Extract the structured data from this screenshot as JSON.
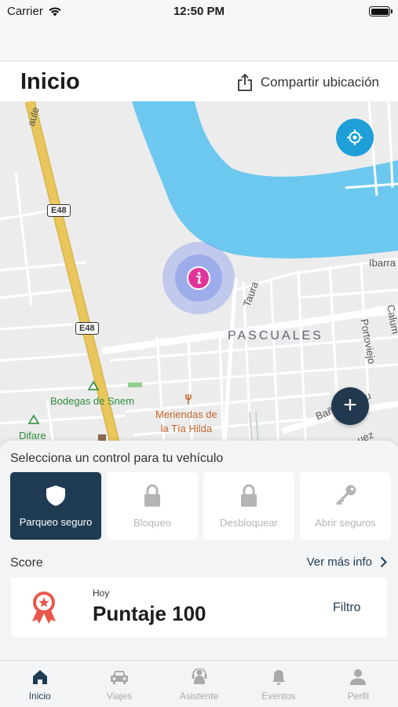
{
  "status_bar": {
    "carrier": "Carrier",
    "time": "12:50 PM"
  },
  "header": {
    "title": "Inicio",
    "share_label": "Compartir ubicación"
  },
  "map": {
    "labels": {
      "road_top_left": "aule",
      "highway_1": "E48",
      "highway_2": "E48",
      "district": "PASCUALES",
      "taura": "Taura",
      "ibarra": "Ibarra",
      "portoviejo": "Portoviejo",
      "calum": "Calum",
      "banos": "Baños De Ju",
      "juez": "uez",
      "bodegas": "Bodegas de Snem",
      "difare": "Difare",
      "meriendas_1": "Meriendas de",
      "meriendas_2": "la Tía Hilda"
    },
    "river_color": "#6cc8ef",
    "highway_color": "#e9c75d"
  },
  "controls": {
    "heading": "Selecciona un control para tu vehículo",
    "items": [
      {
        "label": "Parqueo seguro",
        "icon": "shield-icon",
        "active": true
      },
      {
        "label": "Bloqueo",
        "icon": "lock-icon",
        "active": false
      },
      {
        "label": "Desbloquear",
        "icon": "lock-icon",
        "active": false
      },
      {
        "label": "Abrir seguros",
        "icon": "key-icon",
        "active": false
      }
    ]
  },
  "score": {
    "label": "Score",
    "more_info": "Ver más info",
    "period": "Hoy",
    "value_text": "Puntaje 100",
    "filter": "Filtro"
  },
  "tabs": [
    {
      "label": "Inicio",
      "icon": "home-icon",
      "active": true
    },
    {
      "label": "Viajes",
      "icon": "car-icon",
      "active": false
    },
    {
      "label": "Asistente",
      "icon": "assistant-icon",
      "active": false
    },
    {
      "label": "Eventos",
      "icon": "bell-icon",
      "active": false
    },
    {
      "label": "Perfil",
      "icon": "person-icon",
      "active": false
    }
  ],
  "colors": {
    "primary": "#1f3b52",
    "accent_blue": "#1f9fd8",
    "marker": "#e0359b"
  }
}
